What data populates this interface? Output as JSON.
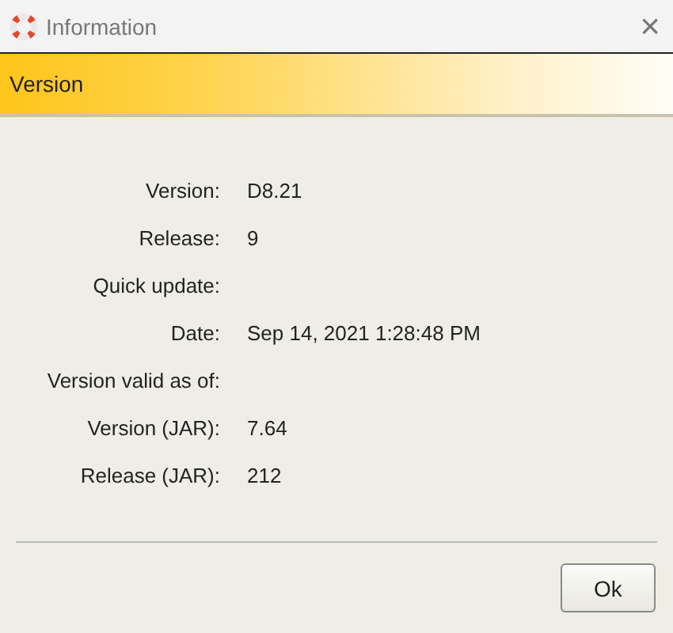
{
  "window": {
    "title": "Information",
    "close": "×"
  },
  "header": {
    "title": "Version"
  },
  "fields": [
    {
      "label": "Version:",
      "value": "D8.21"
    },
    {
      "label": "Release:",
      "value": "9"
    },
    {
      "label": "Quick update:"
    },
    {
      "label": "Date:",
      "value": "Sep 14, 2021 1:28:48 PM"
    },
    {
      "label": "Version valid as of:"
    },
    {
      "label": "Version (JAR):",
      "value": "7.64"
    },
    {
      "label": "Release (JAR):",
      "value": "212"
    }
  ],
  "buttons": [
    "Ok"
  ]
}
